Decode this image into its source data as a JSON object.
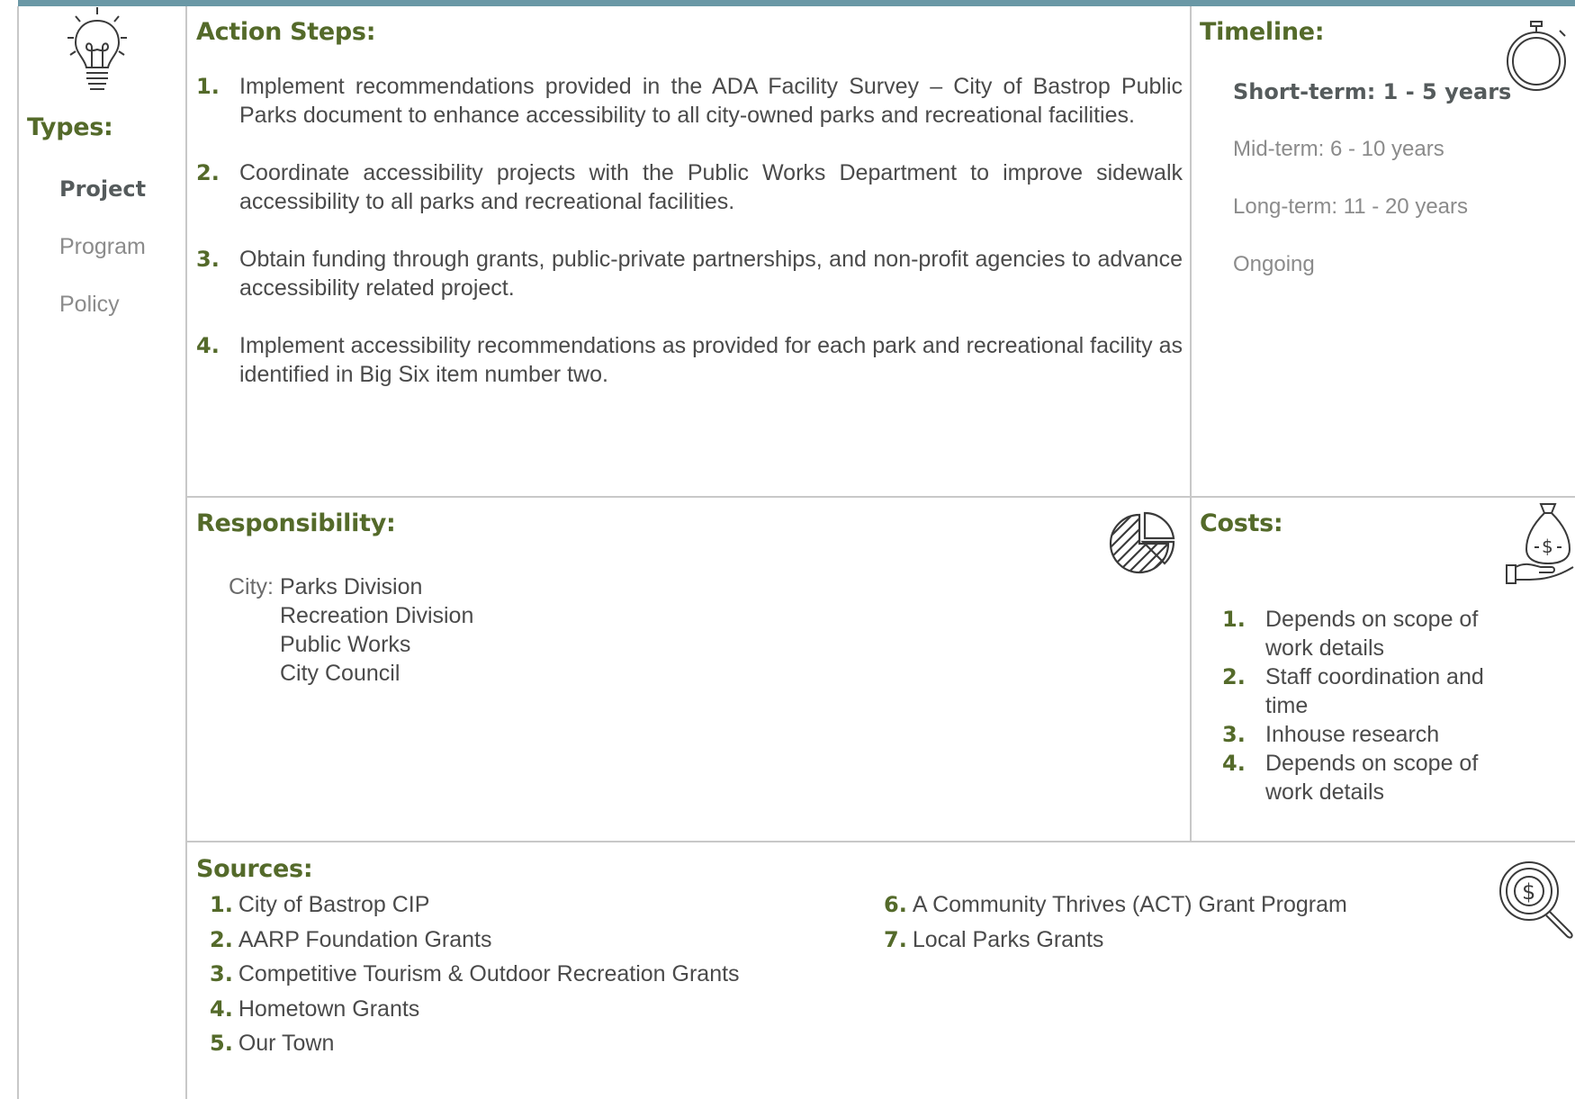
{
  "types": {
    "heading": "Types:",
    "items": [
      {
        "label": "Project",
        "active": true
      },
      {
        "label": "Program",
        "active": false
      },
      {
        "label": "Policy",
        "active": false
      }
    ]
  },
  "action_steps": {
    "heading": "Action Steps:",
    "items": [
      {
        "num": "1.",
        "text": "Implement recommendations provided in the ADA Facility Survey – City of Bastrop Public Parks document to enhance accessibility to all city-owned parks and recreational facilities."
      },
      {
        "num": "2.",
        "text": "Coordinate accessibility projects with the Public Works Department to improve sidewalk accessibility to all parks and recreational facilities."
      },
      {
        "num": "3.",
        "text": "Obtain funding through grants, public-private partnerships, and non-profit agencies to advance accessibility related project."
      },
      {
        "num": "4.",
        "text": "Implement accessibility recommendations as provided for each park and recreational facility as identified in Big Six item number two."
      }
    ]
  },
  "timeline": {
    "heading": "Timeline:",
    "items": [
      {
        "label": "Short-term:  1 - 5 years",
        "active": true
      },
      {
        "label": "Mid-term:  6 - 10 years",
        "active": false
      },
      {
        "label": "Long-term:  11 - 20 years",
        "active": false
      },
      {
        "label": "Ongoing",
        "active": false
      }
    ]
  },
  "responsibility": {
    "heading": "Responsibility:",
    "label": "City:",
    "items": [
      "Parks Division",
      "Recreation Division",
      "Public Works",
      "City Council"
    ]
  },
  "costs": {
    "heading": "Costs:",
    "items": [
      {
        "num": "1.",
        "text": "Depends on scope of work details"
      },
      {
        "num": "2.",
        "text": "Staff coordination and time"
      },
      {
        "num": "3.",
        "text": "Inhouse research"
      },
      {
        "num": "4.",
        "text": "Depends on scope of work details"
      }
    ]
  },
  "sources": {
    "heading": "Sources:",
    "col1": [
      {
        "num": "1.",
        "text": "City of Bastrop CIP"
      },
      {
        "num": "2.",
        "text": "AARP Foundation Grants"
      },
      {
        "num": "3.",
        "text": "Competitive Tourism & Outdoor Recreation Grants"
      },
      {
        "num": "4.",
        "text": "Hometown Grants"
      },
      {
        "num": "5.",
        "text": "Our Town"
      }
    ],
    "col2": [
      {
        "num": "6.",
        "text": "A Community Thrives (ACT) Grant Program"
      },
      {
        "num": "7.",
        "text": "Local Parks Grants"
      }
    ]
  },
  "icons": {
    "types": "lightbulb-icon",
    "timeline": "stopwatch-icon",
    "responsibility": "pie-chart-icon",
    "costs": "money-bag-hand-icon",
    "sources": "magnifier-dollar-icon"
  },
  "colors": {
    "heading": "#546a2a",
    "accent_bar": "#6a98a6",
    "active_text": "#555b5c",
    "inactive_text": "#8b8b8b"
  }
}
